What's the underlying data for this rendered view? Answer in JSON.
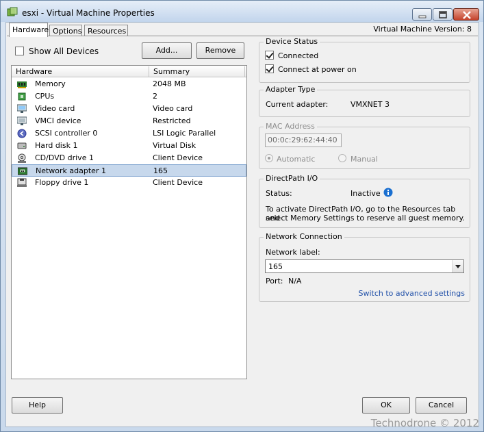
{
  "window": {
    "title": "esxi - Virtual Machine Properties",
    "vm_version": "Virtual Machine Version: 8"
  },
  "tabs": [
    {
      "label": "Hardware",
      "active": true
    },
    {
      "label": "Options",
      "active": false
    },
    {
      "label": "Resources",
      "active": false
    }
  ],
  "hardware": {
    "show_all_devices_label": "Show All Devices",
    "show_all_devices_checked": false,
    "add_label": "Add...",
    "remove_label": "Remove",
    "columns": [
      "Hardware",
      "Summary"
    ],
    "devices": [
      {
        "name": "Memory",
        "summary": "2048 MB",
        "icon": "memory-icon"
      },
      {
        "name": "CPUs",
        "summary": "2",
        "icon": "cpu-icon"
      },
      {
        "name": "Video card",
        "summary": "Video card",
        "icon": "video-card-icon"
      },
      {
        "name": "VMCI device",
        "summary": "Restricted",
        "icon": "vmci-device-icon"
      },
      {
        "name": "SCSI controller 0",
        "summary": "LSI Logic Parallel",
        "icon": "scsi-controller-icon"
      },
      {
        "name": "Hard disk 1",
        "summary": "Virtual Disk",
        "icon": "hard-disk-icon"
      },
      {
        "name": "CD/DVD drive 1",
        "summary": "Client Device",
        "icon": "cd-dvd-icon"
      },
      {
        "name": "Network adapter 1",
        "summary": "165",
        "icon": "network-adapter-icon",
        "selected": true
      },
      {
        "name": "Floppy drive 1",
        "summary": "Client Device",
        "icon": "floppy-drive-icon"
      }
    ]
  },
  "device_status": {
    "label": "Device Status",
    "connected_label": "Connected",
    "connected_checked": true,
    "connect_power_on_label": "Connect at power on",
    "connect_power_on_checked": true
  },
  "adapter_type": {
    "label": "Adapter Type",
    "current_adapter_label": "Current adapter:",
    "current_adapter_value": "VMXNET 3"
  },
  "mac_address": {
    "label": "MAC Address",
    "value": "00:0c:29:62:44:40",
    "automatic_label": "Automatic",
    "manual_label": "Manual",
    "selected": "automatic"
  },
  "directpath": {
    "label": "DirectPath I/O",
    "status_label": "Status:",
    "status_value": "Inactive",
    "info_line1": "To activate DirectPath I/O, go to the Resources tab and",
    "info_line2": "select Memory Settings to reserve all guest memory."
  },
  "network_connection": {
    "label": "Network Connection",
    "network_label_label": "Network label:",
    "network_label_value": "165",
    "port_label": "Port:",
    "port_value": "N/A",
    "advanced_link": "Switch to advanced settings"
  },
  "footer": {
    "help_label": "Help",
    "ok_label": "OK",
    "cancel_label": "Cancel"
  },
  "watermark": "Technodrone © 2012",
  "colors": {
    "selection_bg": "#c7d8ec",
    "link": "#1f4fa8",
    "info_icon": "#1a6fd0"
  }
}
